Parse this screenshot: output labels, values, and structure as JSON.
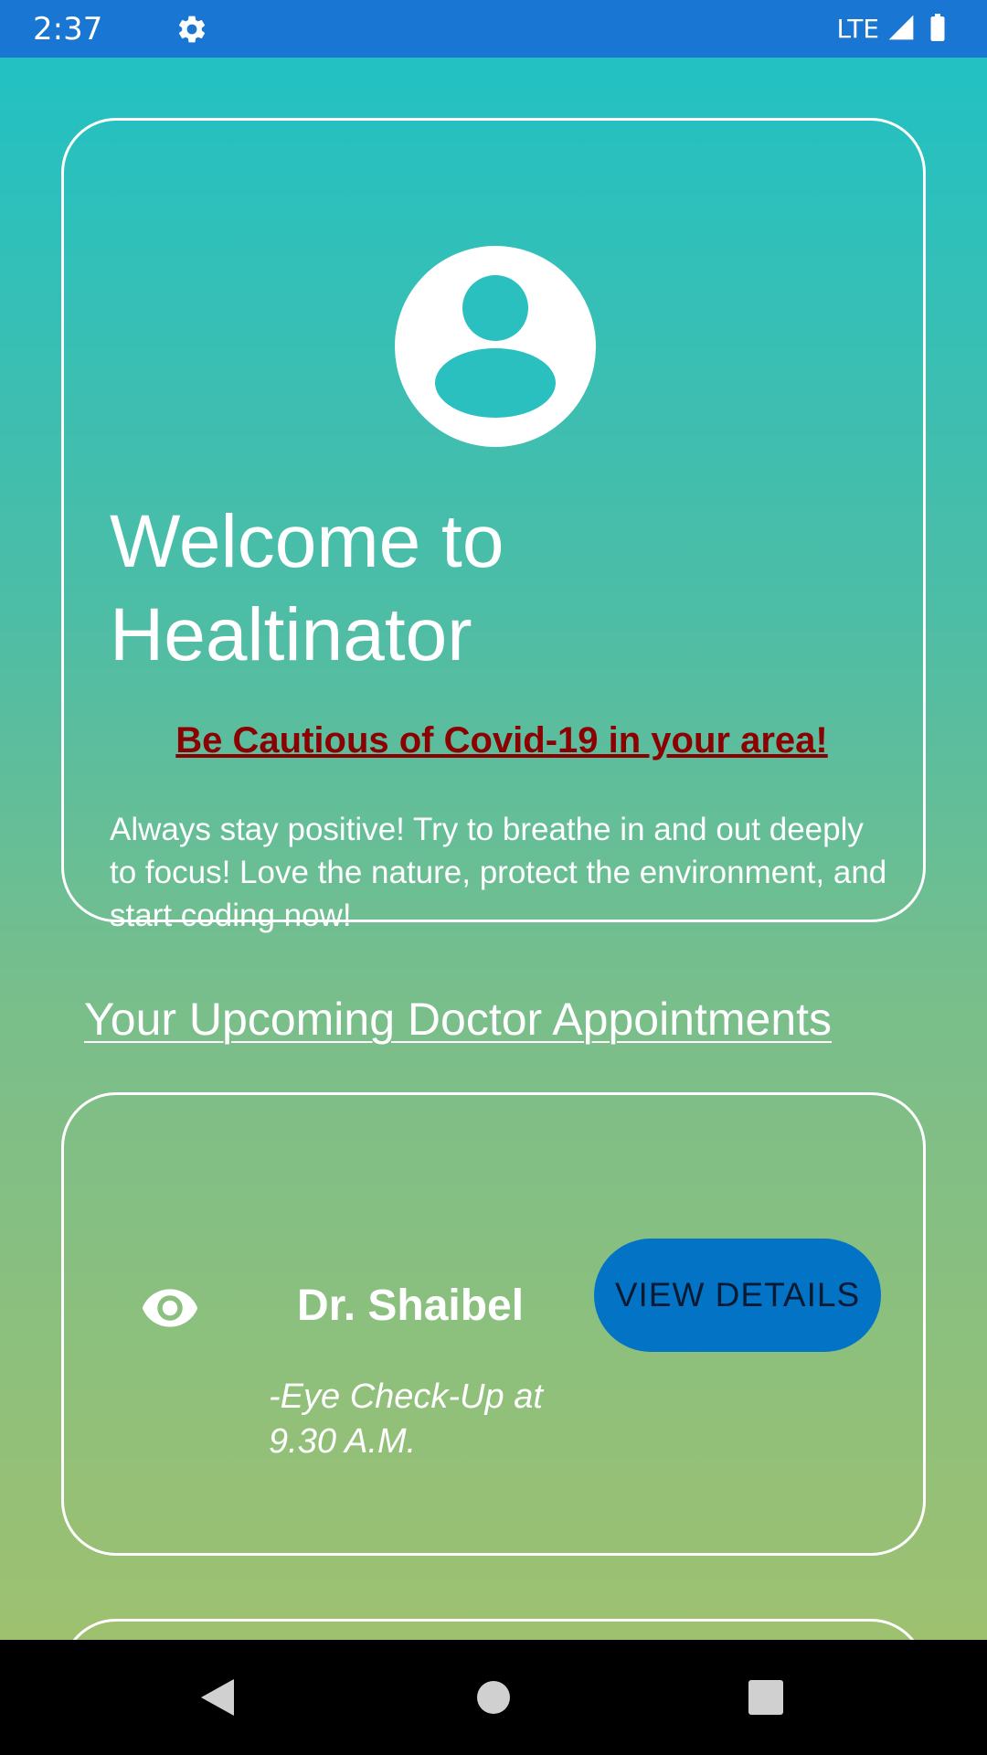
{
  "status_bar": {
    "time": "2:37",
    "network": "LTE",
    "icons": [
      "gear-icon",
      "signal-icon",
      "battery-icon"
    ]
  },
  "welcome": {
    "title": "Welcome to Healtinator",
    "warning": "Be Cautious of Covid-19 in your area!",
    "message": "Always stay positive! Try to breathe in and out deeply to focus! Love the nature, protect the environment, and start coding now!",
    "avatar_icon": "account-circle-icon"
  },
  "appointments": {
    "section_title": "Your Upcoming Doctor Appointments",
    "items": [
      {
        "icon": "eye-icon",
        "doctor": "Dr. Shaibel",
        "description": "-Eye Check-Up at 9.30 A.M.",
        "button_label": "VIEW DETAILS"
      }
    ]
  },
  "nav_bar": {
    "buttons": [
      "back-icon",
      "home-icon",
      "recents-icon"
    ]
  },
  "colors": {
    "status_bar": "#1976D2",
    "gradient_top": "#22C1C3",
    "gradient_bottom": "#9EC170",
    "warning_text": "#8B0000",
    "button_bg": "#0373C6"
  }
}
